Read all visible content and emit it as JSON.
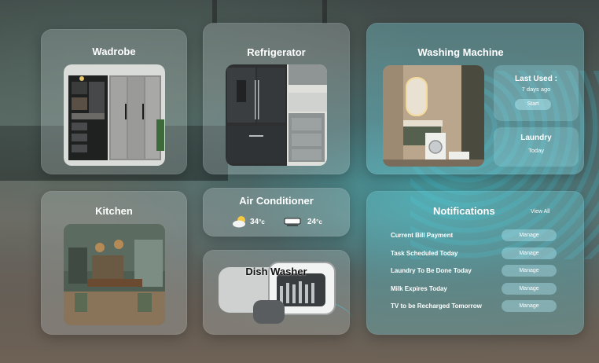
{
  "cards": {
    "wardrobe": {
      "title": "Wadrobe"
    },
    "refrigerator": {
      "title": "Refrigerator"
    },
    "washing_machine": {
      "title": "Washing Machine",
      "last_used": {
        "label": "Last Used :",
        "value": "7 days ago",
        "button": "Start"
      },
      "laundry": {
        "label": "Laundry",
        "value": "Today"
      }
    },
    "kitchen": {
      "title": "Kitchen"
    },
    "air_conditioner": {
      "title": "Air Conditioner",
      "outdoor_temp": "34",
      "indoor_temp": "24",
      "unit": "°c",
      "icons": [
        "weather-sun-cloud-icon",
        "ac-unit-icon"
      ]
    },
    "dish_washer": {
      "title": "Dish Washer"
    }
  },
  "notifications": {
    "title": "Notifications",
    "view_all": "View All",
    "manage_label": "Manage",
    "items": [
      {
        "text": "Current Bill Payment"
      },
      {
        "text": "Task Scheduled Today"
      },
      {
        "text": "Laundry To Be Done Today"
      },
      {
        "text": "Milk Expires Today"
      },
      {
        "text": "TV to be Recharged Tomorrow"
      }
    ]
  },
  "colors": {
    "accent": "#3fd0e0",
    "card": "#c0c8c8"
  }
}
